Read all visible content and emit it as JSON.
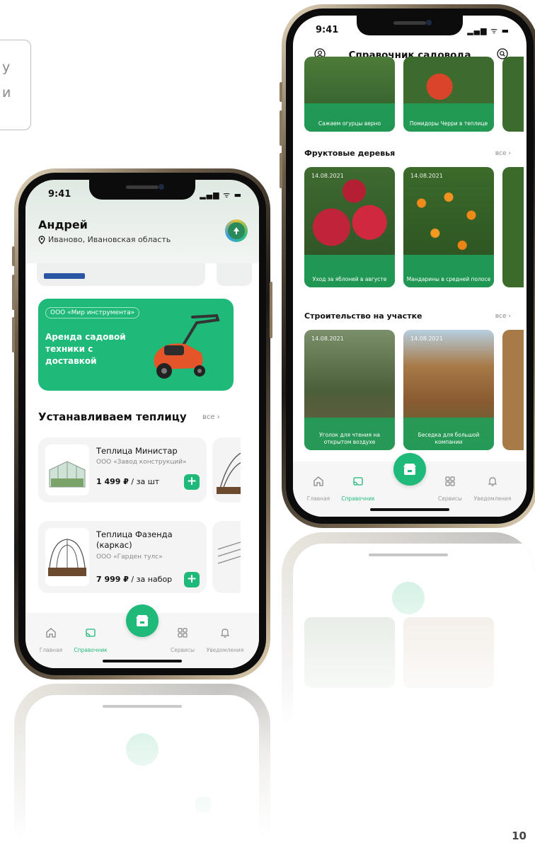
{
  "note": {
    "text": "у\nи"
  },
  "page_number": "10",
  "phone1": {
    "status": {
      "time": "9:41",
      "indicators": "▂▄▆ ᯤ ▬"
    },
    "user": {
      "name": "Андрей",
      "location": "Иваново, Ивановская область"
    },
    "banner": {
      "tag": "ООО «Мир инструмента»",
      "title": "Аренда садовой техники с доставкой"
    },
    "section": {
      "title": "Устанавливаем теплицу",
      "all": "все ›"
    },
    "products": [
      {
        "name": "Теплица Министар",
        "maker": "ООО «Завод конструкций»",
        "price": "1 499 ₽",
        "unit": " / за шт"
      },
      {
        "name": "Теплица Фазенда (каркас)",
        "maker": "ООО «Гарден тулс»",
        "price": "7 999 ₽",
        "unit": " / за набор"
      }
    ],
    "tabs": [
      {
        "label": "Главная",
        "icon": "home-icon"
      },
      {
        "label": "Справочник",
        "icon": "guide-icon"
      },
      {
        "label": "Сервисы",
        "icon": "services-grid-icon"
      },
      {
        "label": "Уведомления",
        "icon": "bell-icon"
      }
    ],
    "active_tab": "Справочник"
  },
  "phone2": {
    "status": {
      "time": "9:41",
      "indicators": "▂▄▆ ᯤ ▬"
    },
    "title": "Справочник садовода",
    "top_cards": [
      {
        "caption": "Сажаем огурцы верно"
      },
      {
        "caption": "Помидоры Черри в теплице"
      }
    ],
    "rows": [
      {
        "title": "Фруктовые деревья",
        "all": "все ›",
        "cards": [
          {
            "date": "14.08.2021",
            "caption": "Уход за яблоней в августе"
          },
          {
            "date": "14.08.2021",
            "caption": "Мандарины в средней полосе"
          }
        ]
      },
      {
        "title": "Строительство на участке",
        "all": "все ›",
        "cards": [
          {
            "date": "14.08.2021",
            "caption": "Уголок для чтения на открытом воздухе"
          },
          {
            "date": "14.08.2021",
            "caption": "Беседка для большой компании"
          }
        ]
      }
    ],
    "tabs": [
      {
        "label": "Главная",
        "icon": "home-icon"
      },
      {
        "label": "Справочник",
        "icon": "guide-icon"
      },
      {
        "label": "Сервисы",
        "icon": "services-grid-icon"
      },
      {
        "label": "Уведомления",
        "icon": "bell-icon"
      }
    ],
    "active_tab": "Справочник"
  },
  "colors": {
    "accent": "#1fb97a",
    "accent_dark": "#1fa05a",
    "frame_gold": "#c9b48f"
  }
}
